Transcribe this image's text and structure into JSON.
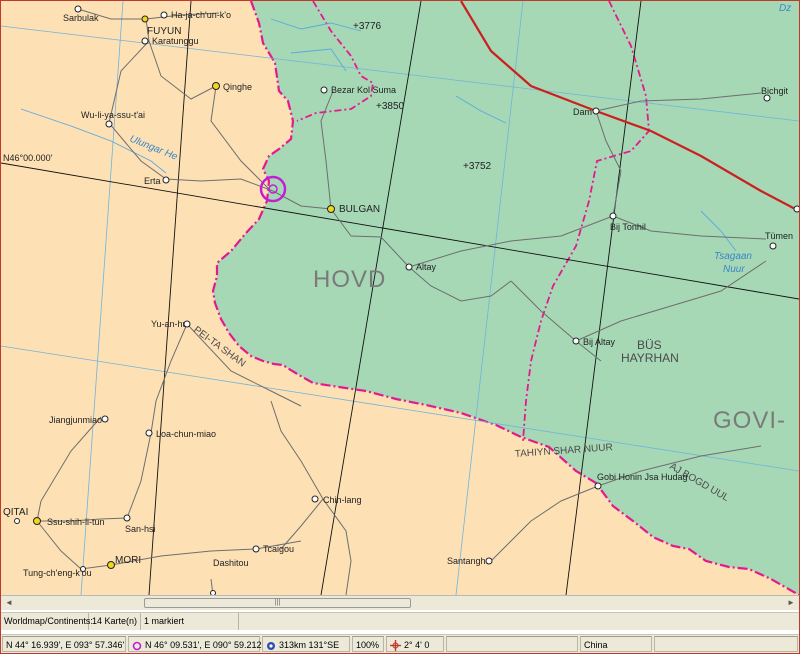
{
  "map": {
    "colors": {
      "land": "#fde1b5",
      "region": "#a6d8b6",
      "border": "#e5198e",
      "road": "#6e6e6e",
      "river": "#5aa8df",
      "railway": "#cc1f1f",
      "marker": "#c11fd6"
    },
    "places": {
      "sarbulak": "Sarbulak",
      "hajachunko": "Ha-ja-ch'un-k'o",
      "fuyun": "FUYUN",
      "karatunggu": "Karatunggu",
      "qinghe": "Qinghe",
      "wulijiasutai": "Wu-li-ya-ssu-t'ai",
      "erta": "Erta",
      "bezarkolsuma": "Bezar Kol Suma",
      "bulgan": "BULGAN",
      "altay": "Altay",
      "dam": "Dam",
      "bichgit": "Bichgit",
      "bijtonhil": "Bij Tonhil",
      "tumen": "Tümen",
      "yuanhu": "Yu-an-hu",
      "bijaltay": "Bij Altay",
      "jiangjunmiao": "Jiangjunmiao",
      "loachunmiao": "Loa-chun-miao",
      "gobi_honin": "Gobi Honin Jsa Hudag",
      "chihlang": "Chih-lang",
      "ssushihliun": "Ssu-shih-li-tun",
      "sanhsi": "San-hsi",
      "qitai": "QITAI",
      "mori": "MORI",
      "tungchengkou": "Tung-ch'eng-k'ou",
      "tcaigou": "Tcaigou",
      "dashitou": "Dashitou",
      "santanghu": "Santanghu"
    },
    "regions": {
      "hovd": "HOVD",
      "govi": "GOVI-",
      "bus_hayrhan_1": "BÜS",
      "bus_hayrhan_2": "HAYRHAN",
      "peitashan": "PEI-TA SHAN",
      "tahiyn": "TAHIYN SHAR NUUR",
      "ajbogd": "AJ BOGD UUL"
    },
    "water": {
      "ulungur": "Ulungar He",
      "tsagaan1": "Tsagaan",
      "tsagaan2": "Nuur",
      "dz": "Dz"
    },
    "peaks": {
      "p3776": "+3776",
      "p3850": "+3850",
      "p3752": "+3752"
    },
    "graticule_label": "N46°00.000'"
  },
  "hscroll": {
    "left_arrow": "◄",
    "right_arrow": "►",
    "grip": "|||"
  },
  "info_bar": {
    "layer": "Worldmap/Continents:",
    "count": "14 Karte(n)",
    "marked": "1 markiert"
  },
  "status_bar": {
    "cursor_coords": "N 44° 16.939', E 093° 57.346'",
    "marker_coords": "N 46° 09.531', E 090° 59.212'",
    "distance": "313km 131°SE",
    "zoom": "100%",
    "grid": "2° 4' 0",
    "country": "China"
  }
}
